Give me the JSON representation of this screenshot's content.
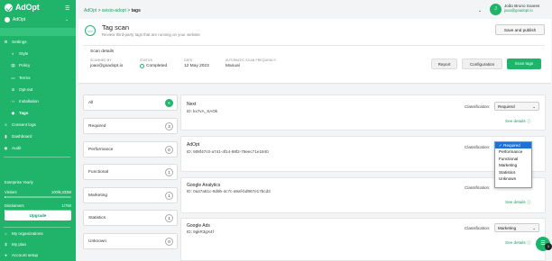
{
  "brand": {
    "name": "AdOpt",
    "accent": "#1fb46a"
  },
  "org": {
    "name": "AdOpt"
  },
  "sidebar": {
    "settings": "Settings",
    "sub_items": [
      "Style",
      "Policy",
      "Terms",
      "Opt-out",
      "Installation",
      "Tags"
    ],
    "items": [
      "Consent logs",
      "Dashboard",
      "Audit"
    ],
    "plan_label": "Enterprise Yearly",
    "visitors_label": "Visitors",
    "visitors_value": "100/8,333M",
    "visitors_fraction": 0.01,
    "disclaimers_label": "Disclaimers",
    "disclaimers_value": "1/750",
    "disclaimers_fraction": 0.01,
    "upgrade_label": "Upgrade",
    "bottom_items": [
      "My organizations",
      "My plan",
      "Account setup"
    ]
  },
  "breadcrumb": [
    "AdOpt",
    "avisio-adopt",
    "tags"
  ],
  "user": {
    "name": "João Bruno Soares",
    "email": "joao@goadopt.io",
    "initial": "J"
  },
  "header": {
    "title": "Tag scan",
    "subtitle": "Review third-party tags that are running on your website",
    "save_publish": "Save and publish",
    "scan_details": "Scan details",
    "meta": [
      {
        "label": "SCANNED BY",
        "value": "joao@goadopt.io"
      },
      {
        "label": "STATUS",
        "value": "Completed"
      },
      {
        "label": "DATE",
        "value": "12 May 2023"
      },
      {
        "label": "AUTOMATIC SCAN FREQUENCY",
        "value": "Manual"
      }
    ],
    "buttons": {
      "report": "Report",
      "configuration": "Configuration",
      "scan_tags": "Scan tags"
    }
  },
  "filters": [
    {
      "label": "All",
      "count": "6"
    },
    {
      "label": "Required",
      "count": "3"
    },
    {
      "label": "Performance",
      "count": "0"
    },
    {
      "label": "Functional",
      "count": "1"
    },
    {
      "label": "Marketing",
      "count": "1"
    },
    {
      "label": "Statistics",
      "count": "1"
    },
    {
      "label": "Unknown",
      "count": "0"
    }
  ],
  "tags": [
    {
      "name": "Next",
      "id": "ID: kx7vA_SAOk",
      "classification": "Required"
    },
    {
      "name": "AdOpt",
      "id": "ID: 908f47c0-a741-4f14-98f2-78eec71e1840",
      "classification": "Required"
    },
    {
      "name": "Google Analytics",
      "id": "ID: 0a47a61c-5d9b-4c7c-a9af-bd967e17bcd3",
      "classification": "Statistics"
    },
    {
      "name": "Google Ads",
      "id": "ID: 9gkR3gX4f",
      "classification": "Marketing"
    }
  ],
  "classification_label": "Classification:",
  "see_details": "See details",
  "dropdown_options": [
    "Required",
    "Performance",
    "Functional",
    "Marketing",
    "Statistics",
    "Unknown"
  ],
  "dropdown_selected": "Required",
  "fab_badge": "1"
}
